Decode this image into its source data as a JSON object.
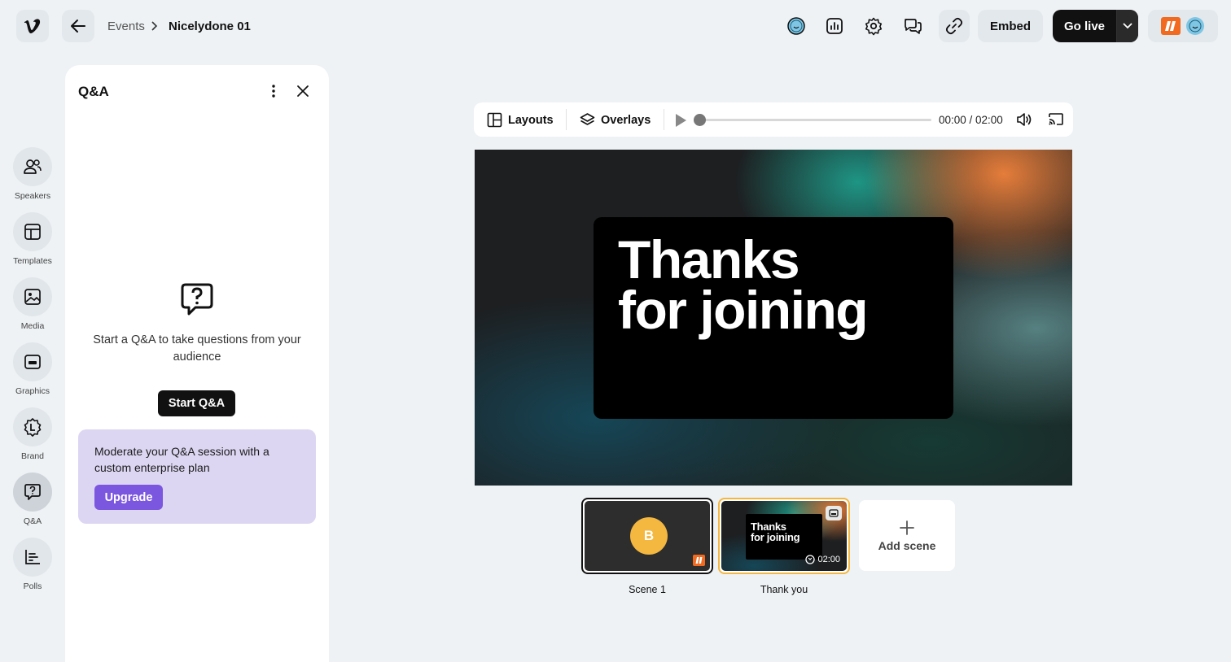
{
  "header": {
    "breadcrumb_parent": "Events",
    "breadcrumb_current": "Nicelydone 01",
    "embed_label": "Embed",
    "golive_label": "Go live"
  },
  "icons": {
    "logo": "vimeo-logo-icon",
    "back": "arrow-left-icon",
    "top": [
      "face-icon",
      "analytics-icon",
      "gear-icon",
      "chat-bubbles-icon",
      "link-icon"
    ],
    "golive_dropdown": "chevron-down-icon"
  },
  "rail": {
    "items": [
      {
        "label": "Speakers",
        "icon": "people-icon"
      },
      {
        "label": "Templates",
        "icon": "layout-icon"
      },
      {
        "label": "Media",
        "icon": "image-icon"
      },
      {
        "label": "Graphics",
        "icon": "graphics-icon"
      },
      {
        "label": "Brand",
        "icon": "brand-icon"
      },
      {
        "label": "Q&A",
        "icon": "question-bubble-icon"
      },
      {
        "label": "Polls",
        "icon": "bar-chart-icon"
      }
    ]
  },
  "panel": {
    "title": "Q&A",
    "empty_message": "Start a Q&A to take questions from your audience",
    "start_button": "Start Q&A",
    "promo_text": "Moderate your Q&A session with a custom enterprise plan",
    "upgrade_button": "Upgrade"
  },
  "toolbar": {
    "layouts_label": "Layouts",
    "overlays_label": "Overlays",
    "time": "00:00 / 02:00",
    "progress": 0
  },
  "stage": {
    "line1": "Thanks",
    "line2": "for joining"
  },
  "scenes": {
    "items": [
      {
        "label": "Scene 1",
        "avatar_letter": "B"
      },
      {
        "label": "Thank you",
        "line1": "Thanks",
        "line2": "for joining",
        "duration": "02:00"
      }
    ],
    "add_label": "Add scene"
  },
  "colors": {
    "accent_purple": "#7b57e0",
    "promo_bg": "#ddd6f2",
    "selected_scene": "#f4b73f",
    "brand_orange": "#f26a1f"
  }
}
